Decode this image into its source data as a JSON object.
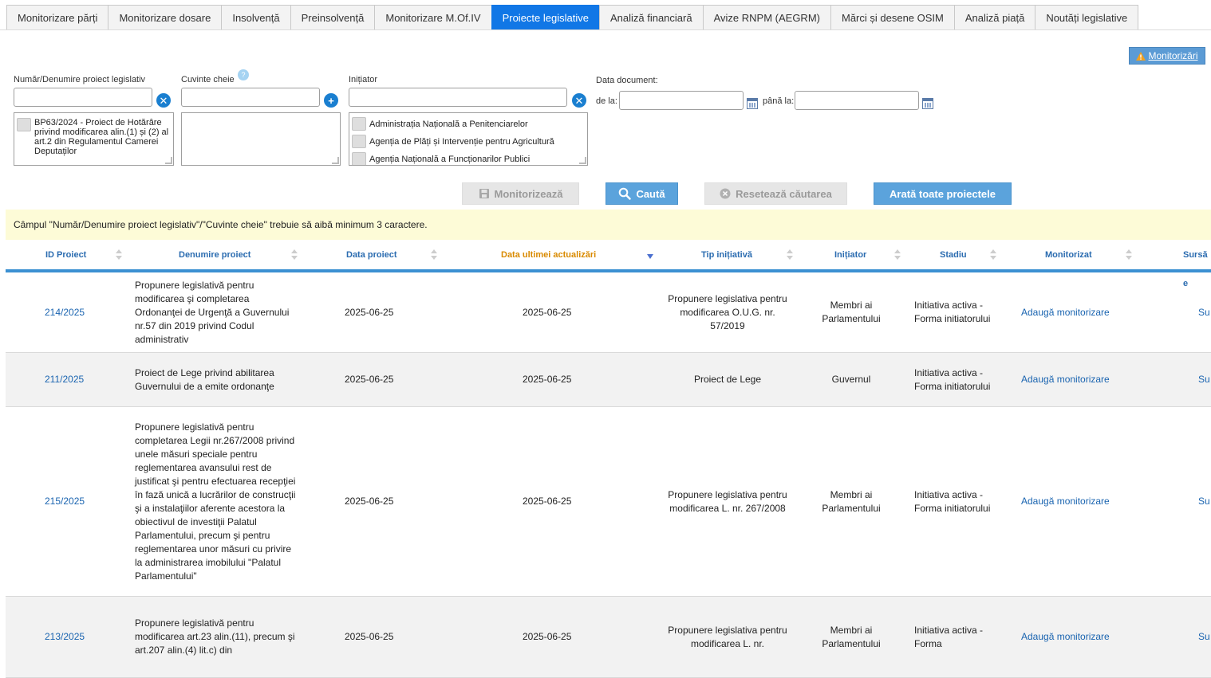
{
  "tabs": [
    {
      "label": "Monitorizare părți",
      "active": false
    },
    {
      "label": "Monitorizare dosare",
      "active": false
    },
    {
      "label": "Insolvență",
      "active": false
    },
    {
      "label": "Preinsolvență",
      "active": false
    },
    {
      "label": "Monitorizare M.Of.IV",
      "active": false
    },
    {
      "label": "Proiecte legislative",
      "active": true
    },
    {
      "label": "Analiză financiară",
      "active": false
    },
    {
      "label": "Avize RNPM (AEGRM)",
      "active": false
    },
    {
      "label": "Mărci și desene OSIM",
      "active": false
    },
    {
      "label": "Analiză piață",
      "active": false
    },
    {
      "label": "Noutăți legislative",
      "active": false
    }
  ],
  "monitorizari_button": "Monitorizări",
  "filters": {
    "proiect_label": "Număr/Denumire proiect legislativ",
    "proiect_value": "",
    "proiect_items": [
      "BP63/2024 - Proiect de Hotărâre privind modificarea alin.(1) și (2) al art.2 din Regulamentul Camerei Deputaților"
    ],
    "cuvinte_label": "Cuvinte cheie",
    "cuvinte_help": "?",
    "cuvinte_value": "",
    "initiator_label": "Inițiator",
    "initiator_value": "",
    "initiator_items": [
      "Administrația Națională a Penitenciarelor",
      "Agenția de Plăți și Intervenție pentru Agricultură",
      "Agenția Națională a Funcționarilor Publici"
    ],
    "data_label": "Data document:",
    "de_la_label": "de la:",
    "pana_la_label": "până la:",
    "de_la_value": "",
    "pana_la_value": ""
  },
  "actions": {
    "monitorizeaza": "Monitorizează",
    "cauta": "Caută",
    "reseteaza": "Resetează căutarea",
    "arata_toate": "Arată toate proiectele"
  },
  "notice": "Câmpul \"Număr/Denumire proiect legislativ\"/\"Cuvinte cheie\" trebuie să aibă minimum 3 caractere.",
  "table": {
    "columns": {
      "id": "ID Proiect",
      "denumire": "Denumire proiect",
      "data_proiect": "Data proiect",
      "data_actualizare": "Data ultimei actualizări",
      "tip": "Tip inițiativă",
      "initiator": "Inițiator",
      "stadiu": "Stadiu",
      "monitorizat": "Monitorizat",
      "sursa": "Sursă e"
    },
    "rows": [
      {
        "id": "214/2025",
        "denumire": "Propunere legislativă pentru modificarea şi completarea Ordonanţei de Urgenţă a Guvernului nr.57 din 2019 privind Codul administrativ",
        "data_proiect": "2025-06-25",
        "data_actualizare": "2025-06-25",
        "tip": "Propunere legislativa pentru modificarea O.U.G. nr. 57/2019",
        "initiator": "Membri ai Parlamentului",
        "stadiu": "Initiativa activa - Forma initiatorului",
        "monitorizat": "Adaugă monitorizare",
        "sursa": "Su"
      },
      {
        "id": "211/2025",
        "denumire": "Proiect de Lege privind abilitarea Guvernului de a emite ordonanţe",
        "data_proiect": "2025-06-25",
        "data_actualizare": "2025-06-25",
        "tip": "Proiect de Lege",
        "initiator": "Guvernul",
        "stadiu": "Initiativa activa - Forma initiatorului",
        "monitorizat": "Adaugă monitorizare",
        "sursa": "Su"
      },
      {
        "id": "215/2025",
        "denumire": "Propunere legislativă pentru completarea Legii nr.267/2008 privind unele măsuri speciale pentru reglementarea avansului rest de justificat şi pentru efectuarea recepţiei în fază unică a lucrărilor de construcţii şi a instalaţiilor aferente acestora la obiectivul de investiţii Palatul Parlamentului, precum şi pentru reglementarea unor măsuri cu privire la administrarea imobilului \"Palatul Parlamentului\"",
        "data_proiect": "2025-06-25",
        "data_actualizare": "2025-06-25",
        "tip": "Propunere legislativa pentru modificarea L. nr. 267/2008",
        "initiator": "Membri ai Parlamentului",
        "stadiu": "Initiativa activa - Forma initiatorului",
        "monitorizat": "Adaugă monitorizare",
        "sursa": "Su"
      },
      {
        "id": "213/2025",
        "denumire": "Propunere legislativă pentru modificarea art.23 alin.(11), precum şi art.207 alin.(4) lit.c) din",
        "data_proiect": "2025-06-25",
        "data_actualizare": "2025-06-25",
        "tip": "Propunere legislativa pentru modificarea L. nr.",
        "initiator": "Membri ai Parlamentului",
        "stadiu": "Initiativa activa - Forma",
        "monitorizat": "Adaugă monitorizare",
        "sursa": "Su"
      }
    ]
  }
}
